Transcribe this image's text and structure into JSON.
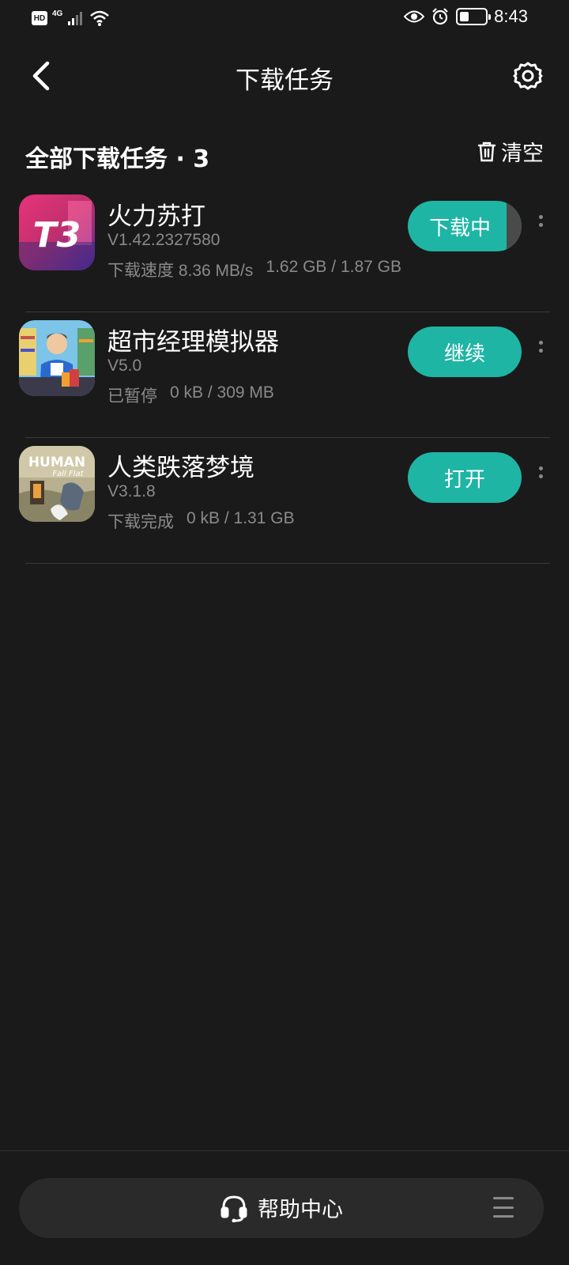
{
  "status_bar": {
    "network_badge": "HD",
    "network_type": "4G",
    "time": "8:43",
    "battery_level": 0.35
  },
  "header": {
    "title": "下载任务",
    "back_icon": "chevron-left-icon",
    "settings_icon": "gear-icon"
  },
  "section": {
    "title": "全部下载任务 · 3",
    "clear_label": "清空",
    "clear_icon": "trash-icon"
  },
  "tasks": [
    {
      "name": "火力苏打",
      "version": "V1.42.2327580",
      "status": "下载速度 8.36 MB/s",
      "size": "1.62 GB / 1.87 GB",
      "action": "下载中",
      "progress": 0.866,
      "icon_text": "T3"
    },
    {
      "name": "超市经理模拟器",
      "version": "V5.0",
      "status": "已暂停",
      "size": "0 kB / 309 MB",
      "action": "继续"
    },
    {
      "name": "人类跌落梦境",
      "version": "V3.1.8",
      "status": "下载完成",
      "size": "0 kB / 1.31 GB",
      "action": "打开",
      "icon_text": "HUMAN",
      "icon_subtext": "Fall Flat"
    }
  ],
  "footer": {
    "help_label": "帮助中心",
    "help_icon": "headset-icon",
    "menu_icon": "menu-icon"
  },
  "colors": {
    "background": "#1a1a1a",
    "accent": "#1fb5a5",
    "muted_text": "#8a8a8a"
  }
}
